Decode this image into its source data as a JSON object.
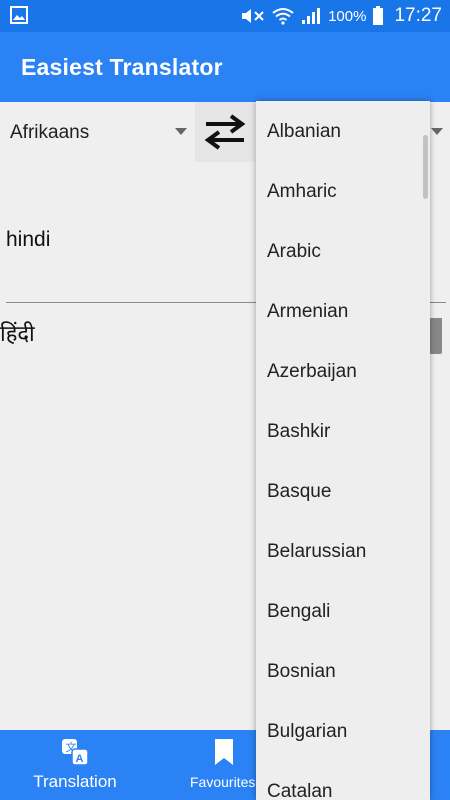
{
  "status_bar": {
    "battery_percent": "100%",
    "time": "17:27"
  },
  "app_bar": {
    "title": "Easiest Translator"
  },
  "source_language": "Afrikaans",
  "input_text": "hindi",
  "output_text": "हिंदी",
  "language_dropdown": {
    "items": [
      "Albanian",
      "Amharic",
      "Arabic",
      "Armenian",
      "Azerbaijan",
      "Bashkir",
      "Basque",
      "Belarussian",
      "Bengali",
      "Bosnian",
      "Bulgarian",
      "Catalan"
    ]
  },
  "bottom_nav": {
    "translation_label": "Translation",
    "favourites_label": "Favourites"
  },
  "colors": {
    "app_bar": "#2b82f4",
    "status_bar": "#1976e8",
    "background": "#efefef"
  }
}
